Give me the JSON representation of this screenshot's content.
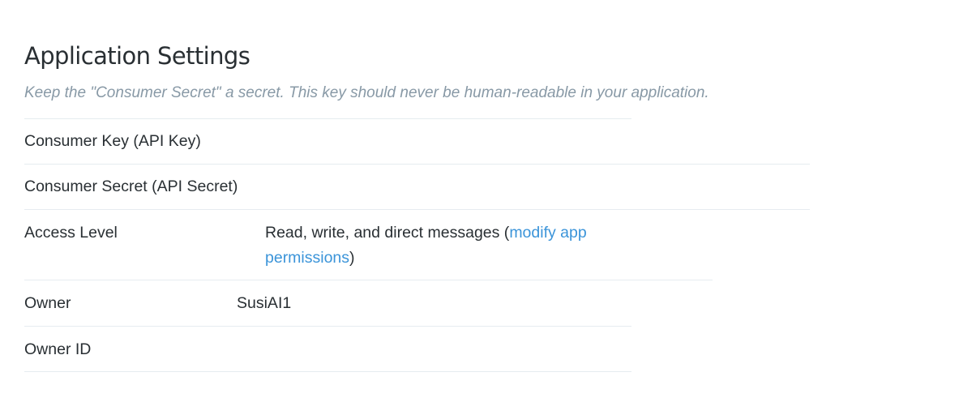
{
  "header": {
    "title": "Application Settings",
    "subtitle": "Keep the \"Consumer Secret\" a secret. This key should never be human-readable in your application."
  },
  "rows": {
    "consumer_key": {
      "label": "Consumer Key (API Key)",
      "value": ""
    },
    "consumer_secret": {
      "label": "Consumer Secret (API Secret)",
      "value": ""
    },
    "access_level": {
      "label": "Access Level",
      "text_before": "Read, write, and direct messages (",
      "link": "modify app permissions",
      "text_after": ")"
    },
    "owner": {
      "label": "Owner",
      "value": "SusiAI1"
    },
    "owner_id": {
      "label": "Owner ID",
      "value": ""
    }
  },
  "colors": {
    "link": "#3b94d9",
    "muted": "#8899a6",
    "text": "#292f33",
    "divider": "#e6ecf0"
  }
}
